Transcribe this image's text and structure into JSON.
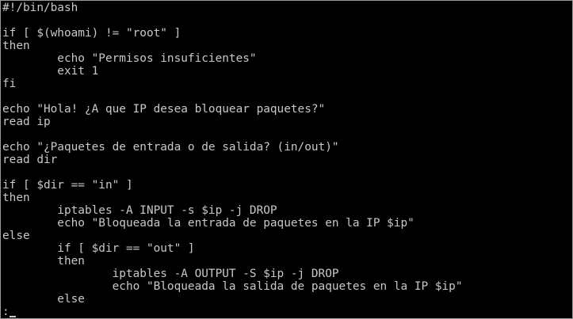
{
  "screen": {
    "lines": [
      "#!/bin/bash",
      "",
      "if [ $(whoami) != \"root\" ]",
      "then",
      "        echo \"Permisos insuficientes\"",
      "        exit 1",
      "fi",
      "",
      "echo \"Hola! ¿A que IP desea bloquear paquetes?\"",
      "read ip",
      "",
      "echo \"¿Paquetes de entrada o de salida? (in/out)\"",
      "read dir",
      "",
      "if [ $dir == \"in\" ]",
      "then",
      "        iptables -A INPUT -s $ip -j DROP",
      "        echo \"Bloqueada la entrada de paquetes en la IP $ip\"",
      "else",
      "        if [ $dir == \"out\" ]",
      "        then",
      "                iptables -A OUTPUT -S $ip -j DROP",
      "                echo \"Bloqueada la salida de paquetes en la IP $ip\"",
      "        else"
    ],
    "prompt": ":"
  },
  "colors": {
    "background": "#000000",
    "foreground": "#c8c8c8"
  }
}
